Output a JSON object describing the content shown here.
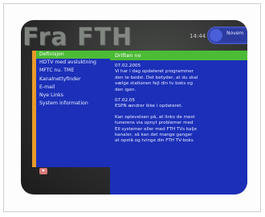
{
  "header": {
    "brand": "Fra FTH",
    "time": "14:44",
    "badge_text": "Novem"
  },
  "sidebar": {
    "items": [
      {
        "label": "Definisjon",
        "selected": true
      },
      {
        "label": "HDTV med avsluktning",
        "selected": false
      },
      {
        "label": "MFTC nu. TME",
        "selected": false
      },
      {
        "label": "Kanalnettyfinder",
        "selected": false
      },
      {
        "label": "E-mail",
        "selected": false
      },
      {
        "label": "Nye Links",
        "selected": false
      },
      {
        "label": "System information",
        "selected": false
      }
    ]
  },
  "main": {
    "title": "Driften no",
    "paragraphs": [
      {
        "lines": [
          {
            "text": "07.02.2005",
            "date": true
          },
          {
            "text": "Vi har i dag opdateret programmer",
            "date": false
          },
          {
            "text": "den te bedst. Det betyder, at du skal",
            "date": false
          },
          {
            "text": "vælge stationen fejl din tv boks og",
            "date": false
          },
          {
            "text": "den igen.",
            "date": false
          }
        ]
      },
      {
        "lines": [
          {
            "text": "07.02.05",
            "date": true
          },
          {
            "text": "ESPN ændrer ikke i opdateret.",
            "date": false
          }
        ]
      },
      {
        "lines": [
          {
            "text": "Kan oplevelsen på, at links de mest",
            "date": false
          },
          {
            "text": "tunerens via opnyt problemer med",
            "date": false
          },
          {
            "text": "Ell systemer eller med FTH TVs kalje",
            "date": false
          },
          {
            "text": "kanaler, så kan det mange ganger",
            "date": false
          },
          {
            "text": "at opstå og tvinge din FTH TV-boks",
            "date": false
          }
        ]
      }
    ]
  },
  "colors": {
    "panel_blue": "#1b2fb8",
    "highlight_green": "#4cbb36",
    "accent_orange": "#e89a2a"
  }
}
